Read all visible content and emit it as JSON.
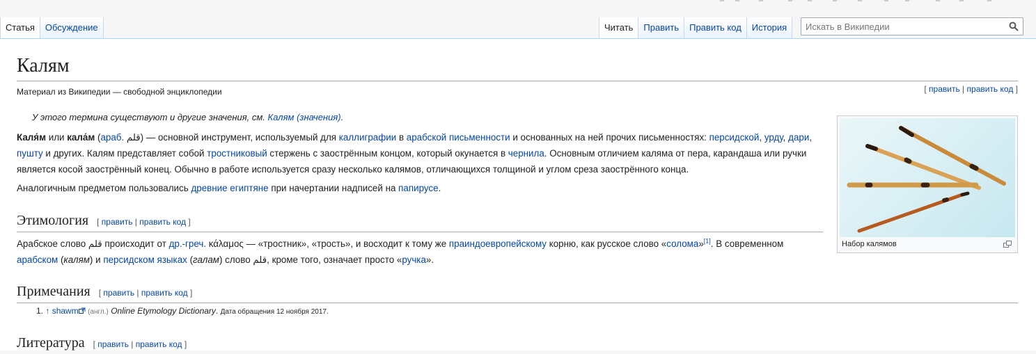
{
  "tabs_left": [
    {
      "label": "Статья",
      "selected": true
    },
    {
      "label": "Обсуждение",
      "selected": false
    }
  ],
  "tabs_right": [
    {
      "label": "Читать",
      "selected": true
    },
    {
      "label": "Править",
      "selected": false
    },
    {
      "label": "Править код",
      "selected": false
    },
    {
      "label": "История",
      "selected": false
    }
  ],
  "search": {
    "placeholder": "Искать в Википедии",
    "icon": "search-icon"
  },
  "article": {
    "title": "Калям",
    "site_sub": "Материал из Википедии — свободной энциклопедии",
    "edit_open": "[ ",
    "edit": "править",
    "edit_sep": " | ",
    "edit_code": "править код",
    "edit_close": " ]",
    "hatnote_prefix": "У этого термина существуют и другие значения, см. ",
    "hatnote_link": "Калям (значения)",
    "hatnote_suffix": "."
  },
  "para1": {
    "t1": "Каля́м",
    "t2": " или ",
    "t3": "кала́м",
    "t4": " (",
    "l_arab": "араб.",
    "arab_word": " قلم",
    "t5": ") — основной инструмент, используемый для ",
    "l_calligraphy": "каллиграфии",
    "t6": " в ",
    "l_arabic_script": "арабской письменности",
    "t7": " и основанных на ней прочих письменностях: ",
    "l_persian": "персидской",
    "t8": ", ",
    "l_urdu": "урду",
    "t9": ", ",
    "l_dari": "дари",
    "t10": ", ",
    "l_pashto": "пушту",
    "t11": " и других. Калям представляет собой ",
    "l_reed": "тростниковый",
    "t12": " стержень с заострённым концом, который окунается в ",
    "l_ink": "чернила",
    "t13": ". Основным отличием каляма от пера, карандаша или ручки является косой заострённый конец. Обычно в работе используется сразу несколько калямов, отличающихся толщиной и углом среза заострённого конца."
  },
  "para2": {
    "t1": "Аналогичным предметом пользовались ",
    "l_egypt": "древние египтяне",
    "t2": " при начертании надписей на ",
    "l_papyrus": "папирусе",
    "t3": "."
  },
  "etymology": {
    "heading": "Этимология",
    "t1": "Арабское слово ",
    "arab1": "قلم",
    "t2": " происходит от ",
    "l_greek": "др.-греч.",
    "greek_word": " κάλαμος",
    "t3": " — «тростник», «трость», и восходит к тому же ",
    "l_pie": "праиндоевропейскому",
    "t4": " корню, как русское слово «",
    "l_straw": "солома",
    "t5": "»",
    "ref1": "[1]",
    "t6": ". В современном ",
    "l_arabic": "арабском",
    "t7": " (",
    "kalyam": "калям",
    "t8": ") и ",
    "l_persian_lang": "персидском языках",
    "t9": " (",
    "galam": "галам",
    "t10": ") слово ",
    "arab2": "قلم",
    "t11": ", кроме того, означает просто «",
    "l_pen": "ручка",
    "t12": "»."
  },
  "notes": {
    "heading": "Примечания",
    "num": "1.",
    "arrow": "↑",
    "l_shawm": "shawm",
    "lang": "(англ.)",
    "source": "Online Etymology Dictionary",
    "dot": ".",
    "access": "Дата обращения 12 ноября 2017."
  },
  "literature": {
    "heading": "Литература"
  },
  "thumb": {
    "caption": "Набор калямов",
    "icon": "magnify-icon"
  },
  "colors": {
    "link": "#0645ad",
    "tab_border": "#a7d7f9",
    "heading_rule": "#a2a9b1"
  }
}
